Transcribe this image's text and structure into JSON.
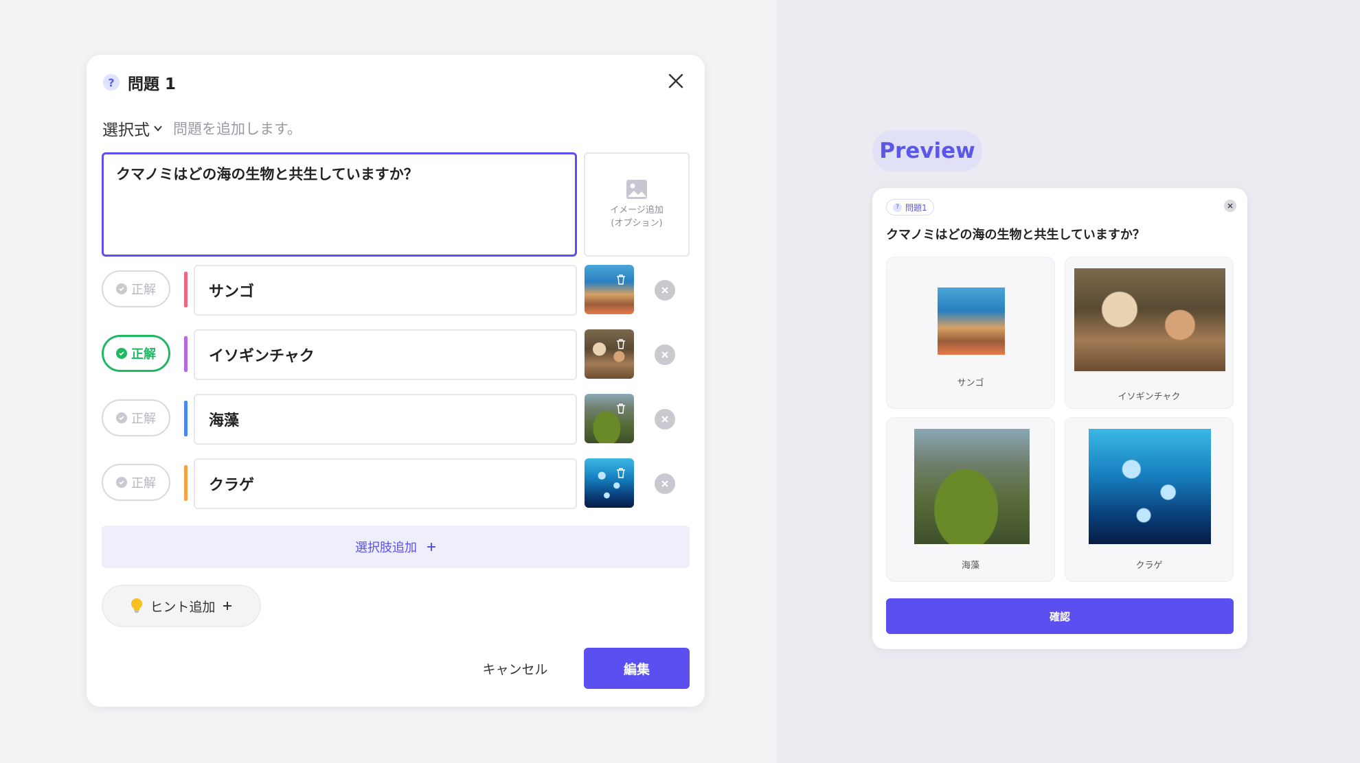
{
  "editor": {
    "badge_icon": "?",
    "title": "問題 1",
    "question_type": "選択式",
    "type_hint": "問題を追加します。",
    "question_text": "クマノミはどの海の生物と共生していますか？",
    "image_add_label_1": "イメージ追加",
    "image_add_label_2": "(オプション)",
    "correct_label": "正解",
    "options": [
      {
        "text": "サンゴ",
        "correct": false,
        "color": "#f0657f",
        "image": "img-coral"
      },
      {
        "text": "イソギンチャク",
        "correct": true,
        "color": "#b768e0",
        "image": "img-anemone"
      },
      {
        "text": "海藻",
        "correct": false,
        "color": "#4a86f0",
        "image": "img-seaweed"
      },
      {
        "text": "クラゲ",
        "correct": false,
        "color": "#f5a14a",
        "image": "img-jelly"
      }
    ],
    "add_choice_label": "選択肢追加",
    "add_hint_label": "ヒント追加",
    "cancel_label": "キャンセル",
    "edit_label": "編集"
  },
  "preview": {
    "label": "Preview",
    "tag": "問題1",
    "question_text": "クマノミはどの海の生物と共生していますか？",
    "options": [
      "サンゴ",
      "イソギンチャク",
      "海藻",
      "クラゲ"
    ],
    "confirm_label": "確認"
  },
  "colors": {
    "accent": "#5b4ff0",
    "correct": "#1fb862"
  }
}
